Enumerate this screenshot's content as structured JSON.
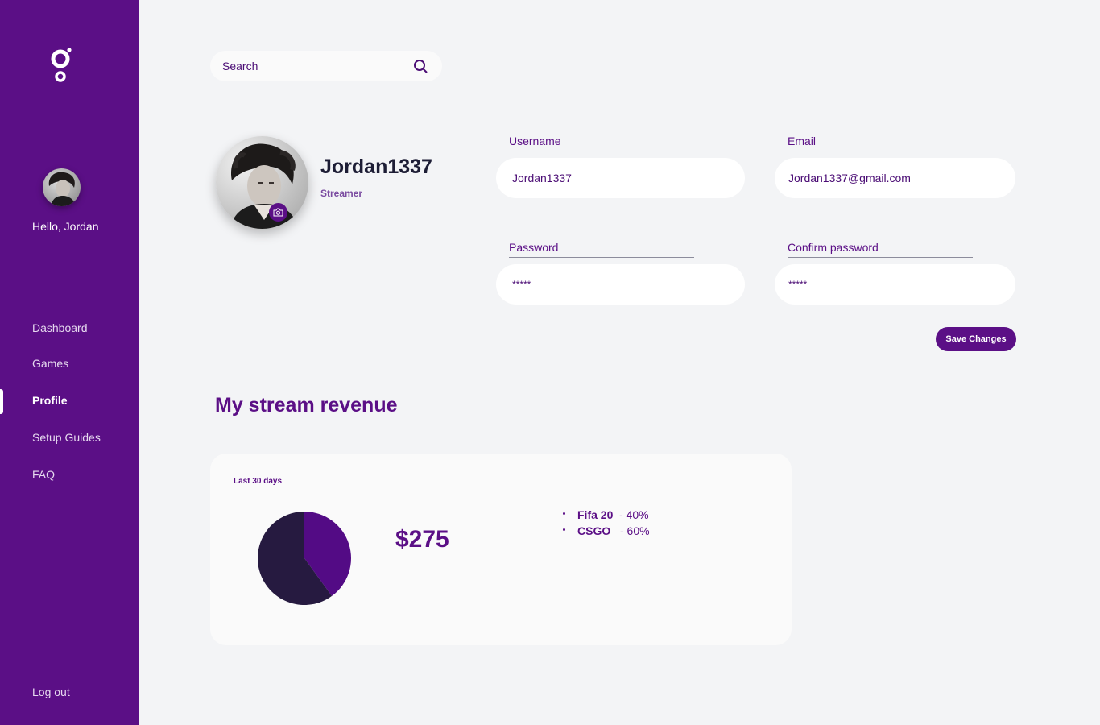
{
  "sidebar": {
    "greeting": "Hello, Jordan",
    "nav": [
      {
        "label": "Dashboard"
      },
      {
        "label": "Games"
      },
      {
        "label": "Profile",
        "active": true
      },
      {
        "label": "Setup Guides"
      },
      {
        "label": "FAQ"
      }
    ],
    "logout_label": "Log out"
  },
  "search": {
    "placeholder": "Search"
  },
  "profile": {
    "name": "Jordan1337",
    "role": "Streamer"
  },
  "form": {
    "username": {
      "label": "Username",
      "value": "Jordan1337"
    },
    "email": {
      "label": "Email",
      "value": "Jordan1337@gmail.com"
    },
    "password": {
      "label": "Password",
      "value": "*****"
    },
    "confirm_password": {
      "label": "Confirm password",
      "value": "*****"
    },
    "save_label": "Save Changes"
  },
  "revenue": {
    "title": "My stream revenue",
    "period": "Last 30 days",
    "amount": "$275",
    "items": [
      {
        "name": "Fifa 20",
        "pct_text": "- 40%"
      },
      {
        "name": "CSGO",
        "pct_text": "- 60%"
      }
    ]
  },
  "chart_data": {
    "type": "pie",
    "categories": [
      "Fifa 20",
      "CSGO"
    ],
    "values": [
      40,
      60
    ],
    "colors": [
      "#530b85",
      "#261a40"
    ]
  },
  "colors": {
    "sidebar": "#5b0f86",
    "accent": "#5b0f86",
    "background": "#f3f4f6"
  }
}
